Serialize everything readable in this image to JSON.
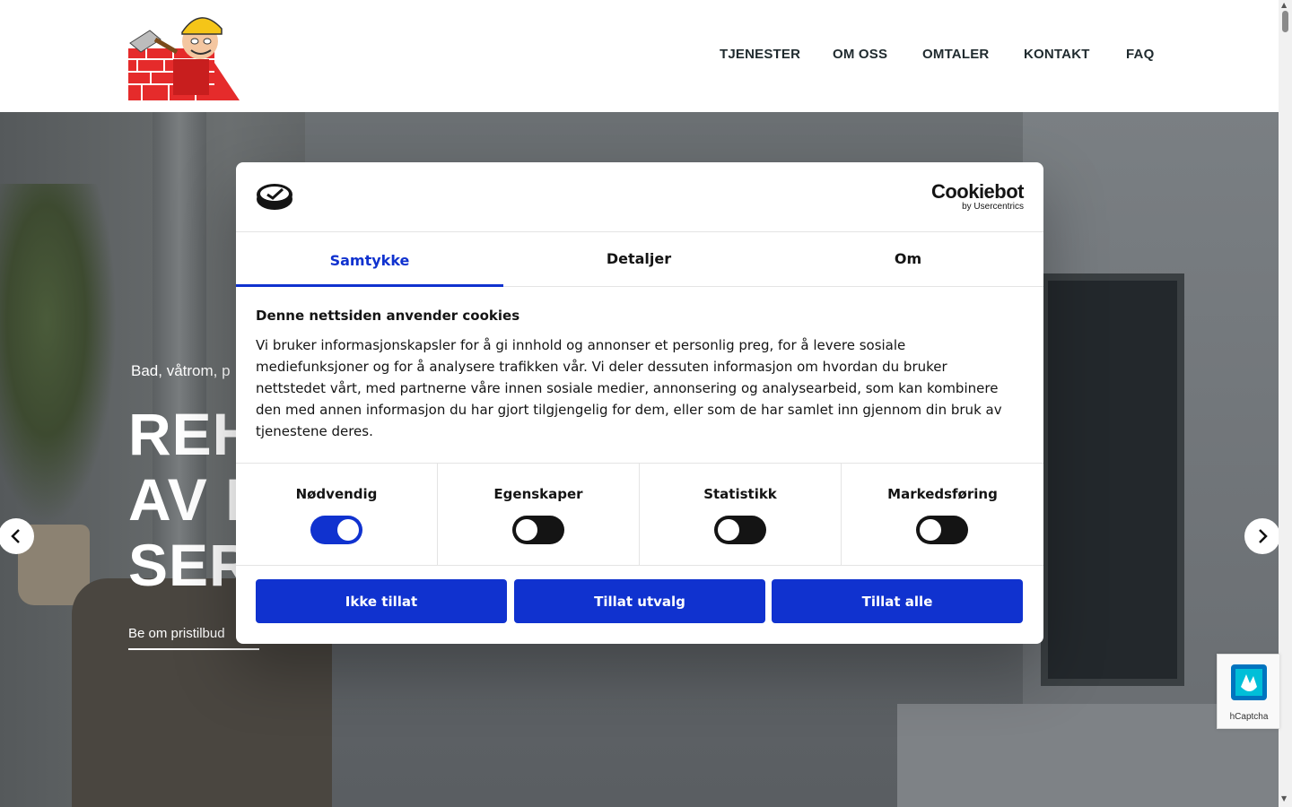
{
  "nav": {
    "items": [
      {
        "label": "TJENESTER"
      },
      {
        "label": "OM OSS"
      },
      {
        "label": "OMTALER"
      },
      {
        "label": "KONTAKT"
      },
      {
        "label": "FAQ"
      }
    ]
  },
  "hero": {
    "subtitle": "Bad, våtrom, p",
    "title_line1": "REH",
    "title_line2": "AV P",
    "title_line3": "SERV",
    "cta": "Be om pristilbud"
  },
  "cookie_dialog": {
    "brand_name": "Cookiebot",
    "brand_sub": "by Usercentrics",
    "tabs": [
      {
        "label": "Samtykke",
        "active": true
      },
      {
        "label": "Detaljer",
        "active": false
      },
      {
        "label": "Om",
        "active": false
      }
    ],
    "heading": "Denne nettsiden anvender cookies",
    "body": "Vi bruker informasjonskapsler for å gi innhold og annonser et personlig preg, for å levere sosiale mediefunksjoner og for å analysere trafikken vår. Vi deler dessuten informasjon om hvordan du bruker nettstedet vårt, med partnerne våre innen sosiale medier, annonsering og analysearbeid, som kan kombinere den med annen informasjon du har gjort tilgjengelig for dem, eller som de har samlet inn gjennom din bruk av tjenestene deres.",
    "toggles": [
      {
        "label": "Nødvendig",
        "on": true
      },
      {
        "label": "Egenskaper",
        "on": false
      },
      {
        "label": "Statistikk",
        "on": false
      },
      {
        "label": "Markedsføring",
        "on": false
      }
    ],
    "buttons": {
      "deny": "Ikke tillat",
      "allow_selection": "Tillat utvalg",
      "allow_all": "Tillat alle"
    },
    "accent_color": "#1032cf"
  },
  "captcha": {
    "label": "hCaptcha"
  }
}
